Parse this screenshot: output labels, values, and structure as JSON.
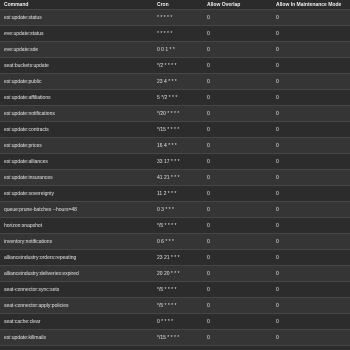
{
  "table": {
    "headers": [
      "Command",
      "Cron",
      "Allow Overlap",
      "Allow In Maintenance Mode"
    ],
    "rows": [
      {
        "command": "esi:update:status",
        "cron": "* * * * *",
        "overlap": "0",
        "maintenance": "0"
      },
      {
        "command": "eve:update:status",
        "cron": "* * * * *",
        "overlap": "0",
        "maintenance": "0"
      },
      {
        "command": "eve:update:sde",
        "cron": "0 0 1 * *",
        "overlap": "0",
        "maintenance": "0"
      },
      {
        "command": "seat:buckets:update",
        "cron": "*/2 * * * *",
        "overlap": "0",
        "maintenance": "0"
      },
      {
        "command": "esi:update:public",
        "cron": "23 4 * * *",
        "overlap": "0",
        "maintenance": "0"
      },
      {
        "command": "esi:update:affiliations",
        "cron": "5 */2 * * *",
        "overlap": "0",
        "maintenance": "0"
      },
      {
        "command": "esi:update:notifications",
        "cron": "*/20 * * * *",
        "overlap": "0",
        "maintenance": "0"
      },
      {
        "command": "esi:update:contracts",
        "cron": "*/15 * * * *",
        "overlap": "0",
        "maintenance": "0"
      },
      {
        "command": "esi:update:prices",
        "cron": "16 4 * * *",
        "overlap": "0",
        "maintenance": "0"
      },
      {
        "command": "esi:update:alliances",
        "cron": "33 17 * * *",
        "overlap": "0",
        "maintenance": "0"
      },
      {
        "command": "esi:update:insurances",
        "cron": "41 21 * * *",
        "overlap": "0",
        "maintenance": "0"
      },
      {
        "command": "esi:update:sovereignty",
        "cron": "11 2 * * *",
        "overlap": "0",
        "maintenance": "0"
      },
      {
        "command": "queue:prune-batches --hours=48",
        "cron": "0 3 * * *",
        "overlap": "0",
        "maintenance": "0"
      },
      {
        "command": "horizon:snapshot",
        "cron": "*/5 * * * *",
        "overlap": "0",
        "maintenance": "0"
      },
      {
        "command": "inventory:notifications",
        "cron": "0 6 * * *",
        "overlap": "0",
        "maintenance": "0"
      },
      {
        "command": "allianceindustry:orders:repeating",
        "cron": "23 21 * * *",
        "overlap": "0",
        "maintenance": "0"
      },
      {
        "command": "allianceindustry:deliveries:expired",
        "cron": "20 20 * * *",
        "overlap": "0",
        "maintenance": "0"
      },
      {
        "command": "seat-connector:sync:sets",
        "cron": "*/5 * * * *",
        "overlap": "0",
        "maintenance": "0"
      },
      {
        "command": "seat-connector:apply:policies",
        "cron": "*/5 * * * *",
        "overlap": "0",
        "maintenance": "0"
      },
      {
        "command": "seat:cache:clear",
        "cron": "0 * * * *",
        "overlap": "0",
        "maintenance": "0"
      },
      {
        "command": "esi:update:killmails",
        "cron": "*/15 * * * *",
        "overlap": "0",
        "maintenance": "0"
      }
    ]
  }
}
